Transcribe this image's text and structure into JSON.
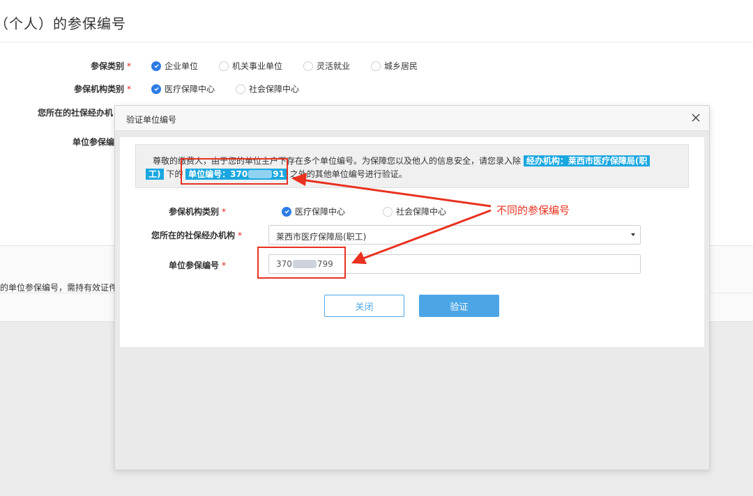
{
  "page": {
    "title": "（个人）的参保编号",
    "form": {
      "insurance_type": {
        "label": "参保类别",
        "options": [
          "企业单位",
          "机关事业单位",
          "灵活就业",
          "城乡居民"
        ],
        "selected": "企业单位"
      },
      "agency_type": {
        "label": "参保机构类别",
        "options": [
          "医疗保障中心",
          "社会保障中心"
        ],
        "selected": "医疗保障中心"
      },
      "agency_label": "您所在的社保经办机",
      "unit_number_label": "单位参保编"
    },
    "notice_text": "的单位参保编号，需持有效证件"
  },
  "modal": {
    "title": "验证单位编号",
    "alert": {
      "text_before": "尊敬的缴费人，由于您的单位主户下存在多个单位编号。为保障您以及他人的信息安全，请您录入除",
      "agency_highlight_1": "经办机构：莱西市医疗保障局(职",
      "agency_highlight_2": "工)",
      "text_mid": "下的",
      "unit_highlight_prefix": "单位编号：370",
      "unit_highlight_suffix": "91",
      "text_after": "之外的其他单位编号进行验证。"
    },
    "agency_type": {
      "label": "参保机构类别",
      "options": [
        "医疗保障中心",
        "社会保障中心"
      ],
      "selected": "医疗保障中心"
    },
    "agency": {
      "label": "您所在的社保经办机构",
      "value": "莱西市医疗保障局(职工)"
    },
    "unit_number": {
      "label": "单位参保编号",
      "value_prefix": "370",
      "value_suffix": "799"
    },
    "buttons": {
      "close": "关闭",
      "verify": "验证"
    }
  },
  "annotation": {
    "text": "不同的参保编号",
    "color": "#e8311f"
  },
  "colors": {
    "accent": "#2c7be5",
    "highlight": "#1aa7e0",
    "button": "#4ca6e6",
    "required": "#e2211c"
  }
}
